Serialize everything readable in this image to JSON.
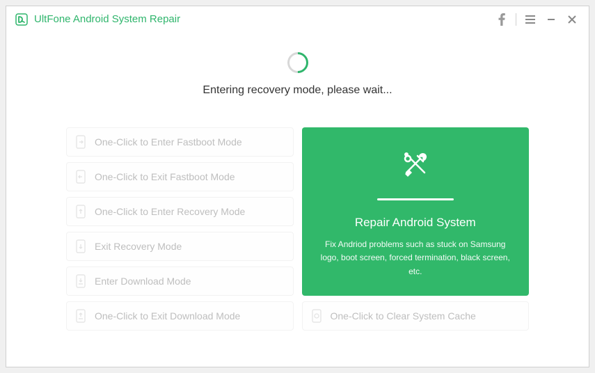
{
  "app": {
    "title": "UltFone Android System Repair"
  },
  "status": {
    "message": "Entering recovery mode, please wait..."
  },
  "options": {
    "enter_fastboot": "One-Click to Enter Fastboot Mode",
    "exit_fastboot": "One-Click to Exit Fastboot Mode",
    "enter_recovery": "One-Click to Enter Recovery Mode",
    "exit_recovery": "Exit Recovery Mode",
    "enter_download": "Enter Download Mode",
    "exit_download": "One-Click to Exit Download Mode",
    "clear_cache": "One-Click to Clear System Cache"
  },
  "main_card": {
    "title": "Repair Android System",
    "description": "Fix Andriod problems such as stuck on Samsung logo, boot screen, forced termination, black screen, etc."
  },
  "colors": {
    "accent": "#2fb56c",
    "card_bg": "#31b86a"
  }
}
